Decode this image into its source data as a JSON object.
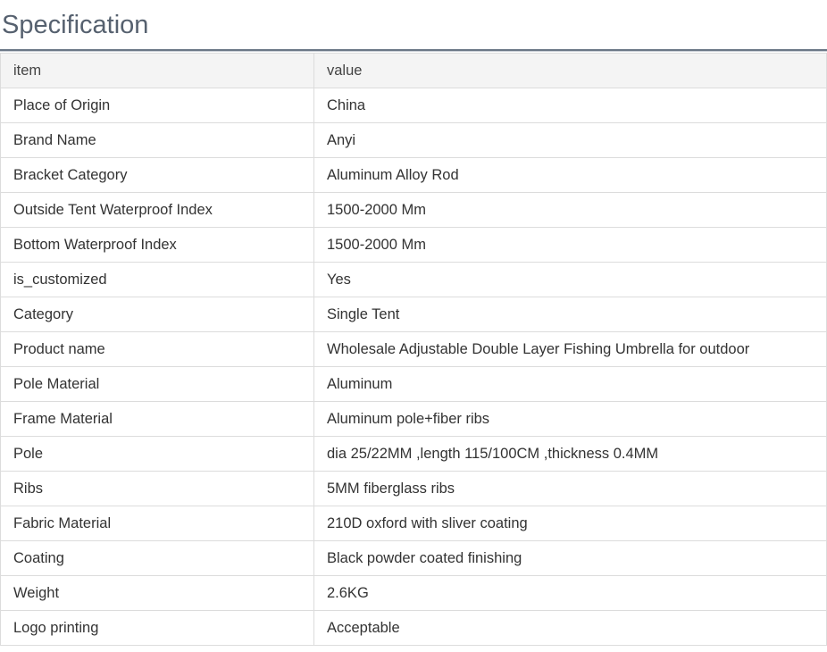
{
  "page": {
    "title": "Specification"
  },
  "table": {
    "header": {
      "key": "item",
      "value": "value"
    },
    "rows": [
      {
        "key": "Place of Origin",
        "value": "China"
      },
      {
        "key": "Brand Name",
        "value": "Anyi"
      },
      {
        "key": "Bracket Category",
        "value": "Aluminum Alloy Rod"
      },
      {
        "key": "Outside Tent Waterproof Index",
        "value": "1500-2000 Mm"
      },
      {
        "key": "Bottom Waterproof Index",
        "value": "1500-2000 Mm"
      },
      {
        "key": "is_customized",
        "value": "Yes"
      },
      {
        "key": "Category",
        "value": "Single Tent"
      },
      {
        "key": "Product name",
        "value": "Wholesale Adjustable Double Layer Fishing Umbrella for outdoor"
      },
      {
        "key": "Pole Material",
        "value": "Aluminum"
      },
      {
        "key": "Frame Material",
        "value": "Aluminum pole+fiber ribs"
      },
      {
        "key": "Pole",
        "value": "dia 25/22MM ,length 115/100CM ,thickness 0.4MM"
      },
      {
        "key": "Ribs",
        "value": "5MM fiberglass ribs"
      },
      {
        "key": "Fabric Material",
        "value": "210D oxford with sliver coating"
      },
      {
        "key": "Coating",
        "value": "Black powder coated finishing"
      },
      {
        "key": "Weight",
        "value": "2.6KG"
      },
      {
        "key": "Logo printing",
        "value": "Acceptable"
      }
    ]
  }
}
